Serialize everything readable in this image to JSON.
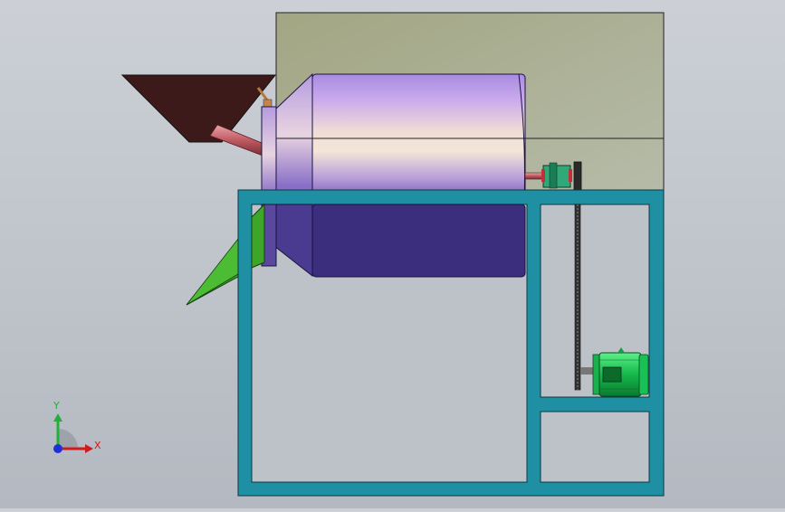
{
  "viewport": {
    "background": [
      "#ccd0d6",
      "#b4b9c1"
    ],
    "colors": {
      "enclosure_panel": "#a8ad8e",
      "drum_body": "#a48ad6",
      "drum_shadow": "#3a2f70",
      "frame": "#1f8fa3",
      "hopper": "#3a1818",
      "feed_pipe": "#c86a70",
      "discharge_chute": "#3ea82a",
      "motor": "#1ecf5c",
      "chain": "#222222"
    }
  },
  "triad": {
    "x_label": "X",
    "y_label": "Y",
    "x_color": "#d11a1a",
    "y_color": "#22b03a",
    "z_color": "#1f2fd8"
  }
}
